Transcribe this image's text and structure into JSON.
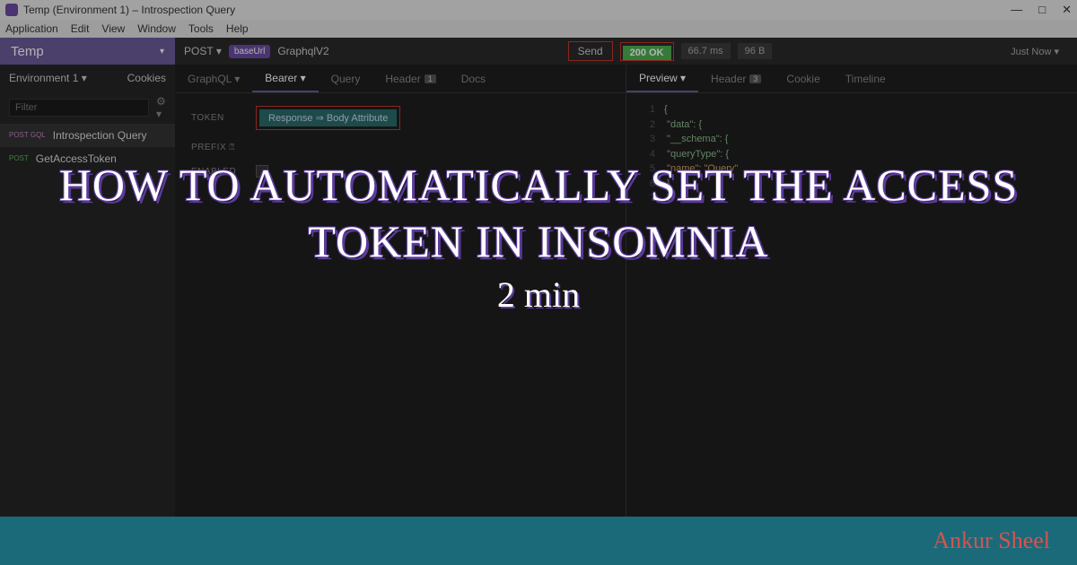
{
  "window": {
    "title": "Temp (Environment 1) – Introspection Query",
    "controls": {
      "min": "—",
      "max": "□",
      "close": "✕"
    }
  },
  "menubar": [
    "Application",
    "Edit",
    "View",
    "Window",
    "Tools",
    "Help"
  ],
  "workspace": {
    "name": "Temp",
    "caret": "▾"
  },
  "request": {
    "method": "POST",
    "method_caret": "▾",
    "pill": "baseUrl",
    "name": "GraphqlV2",
    "send": "Send",
    "status": "200 OK",
    "time": "66.7 ms",
    "size": "96 B",
    "just_now": "Just Now ▾"
  },
  "sidebar": {
    "env": "Environment 1 ▾",
    "cookies": "Cookies",
    "filter_placeholder": "Filter",
    "gear": "⚙ ▾",
    "items": [
      {
        "tag": "POST GQL",
        "name": "Introspection Query",
        "active": true
      },
      {
        "tag": "POST",
        "name": "GetAccessToken",
        "active": false
      }
    ]
  },
  "left_tabs": [
    "GraphQL ▾",
    "Bearer ▾",
    "Query",
    "Header",
    "Docs"
  ],
  "left_tabs_active": 1,
  "left_header_badge": "1",
  "token_form": {
    "token_label": "TOKEN",
    "token_chip": "Response ⇒ Body Attribute",
    "prefix_label": "PREFIX ⍰",
    "enabled_label": "ENABLED",
    "enabled_check": "✓"
  },
  "right_tabs": [
    "Preview ▾",
    "Header",
    "Cookie",
    "Timeline"
  ],
  "right_tabs_active": 0,
  "right_header_badge": "3",
  "response_json": [
    {
      "n": 1,
      "text": "{"
    },
    {
      "n": 2,
      "text": "  \"data\": {"
    },
    {
      "n": 3,
      "text": "    \"__schema\": {"
    },
    {
      "n": 4,
      "text": "      \"queryType\": {"
    },
    {
      "n": 5,
      "text": "        \"name\": \"Query\""
    },
    {
      "n": 6,
      "text": "      }"
    },
    {
      "n": 7,
      "text": "    }"
    }
  ],
  "overlay": {
    "title": "HOW TO AUTOMATICALLY SET THE ACCESS TOKEN IN INSOMNIA",
    "subtitle": "2 min",
    "author": "Ankur Sheel"
  }
}
